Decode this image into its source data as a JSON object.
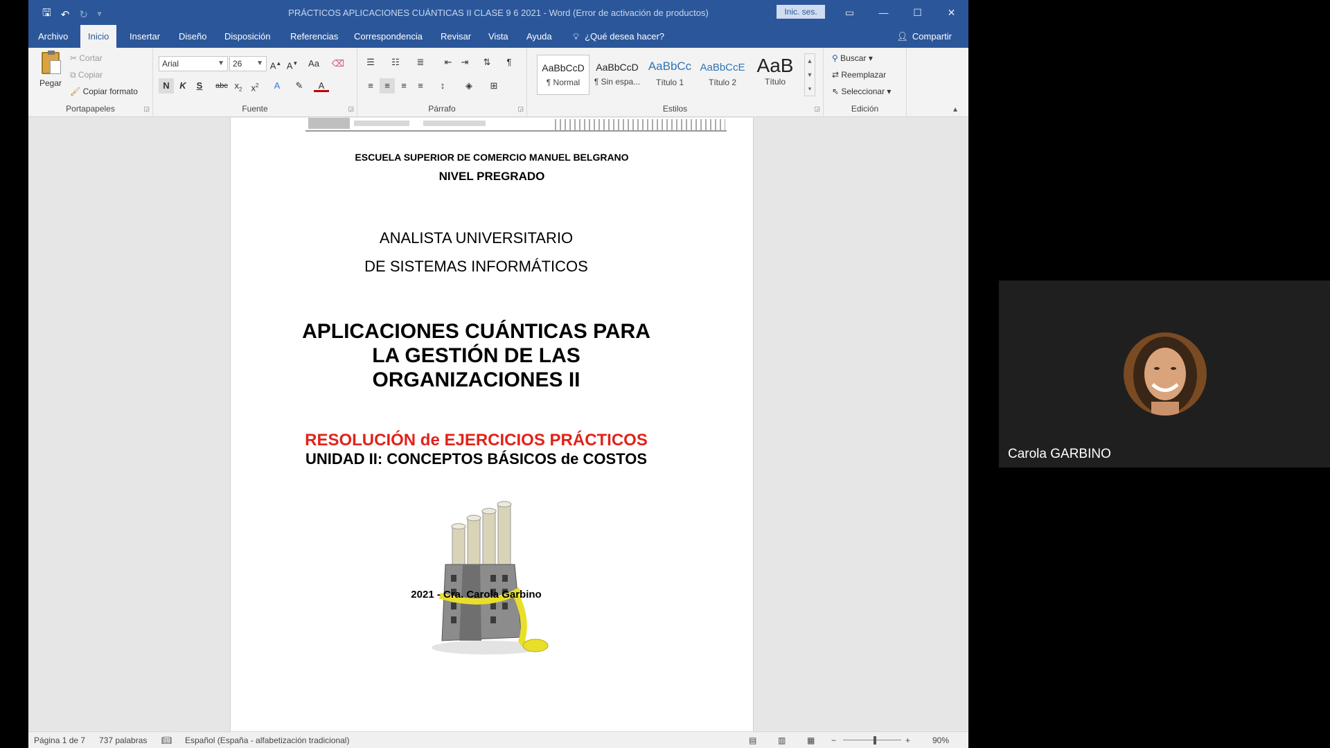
{
  "window": {
    "title": "PRÁCTICOS APLICACIONES CUÁNTICAS II  CLASE 9 6 2021  -  Word (Error de activación de productos)",
    "signin_label": "Inic. ses.",
    "accent": "#2b579a"
  },
  "tabs": [
    "Archivo",
    "Inicio",
    "Insertar",
    "Diseño",
    "Disposición",
    "Referencias",
    "Correspondencia",
    "Revisar",
    "Vista",
    "Ayuda"
  ],
  "tellme": "¿Qué desea hacer?",
  "share": "Compartir",
  "ribbon": {
    "clipboard": {
      "paste": "Pegar",
      "cut": "Cortar",
      "copy": "Copiar",
      "format_painter": "Copiar formato",
      "label": "Portapapeles"
    },
    "font": {
      "name": "Arial",
      "size": "26",
      "label": "Fuente",
      "bold": "N",
      "italic": "K",
      "underline": "S",
      "strike": "abc",
      "change_case": "Aa"
    },
    "paragraph": {
      "label": "Párrafo"
    },
    "styles": {
      "label": "Estilos",
      "items": [
        {
          "preview": "AaBbCcD",
          "name": "¶ Normal"
        },
        {
          "preview": "AaBbCcD",
          "name": "¶ Sin espa..."
        },
        {
          "preview": "AaBbCc",
          "name": "Título 1"
        },
        {
          "preview": "AaBbCcE",
          "name": "Título 2"
        },
        {
          "preview": "AaB",
          "name": "Título"
        }
      ]
    },
    "editing": {
      "find": "Buscar",
      "replace": "Reemplazar",
      "select": "Seleccionar",
      "label": "Edición"
    }
  },
  "document": {
    "school": "ESCUELA SUPERIOR DE COMERCIO MANUEL BELGRANO",
    "level": "NIVEL PREGRADO",
    "degree_1": "ANALISTA UNIVERSITARIO",
    "degree_2": "DE SISTEMAS INFORMÁTICOS",
    "subject_1": "APLICACIONES CUÁNTICAS PARA",
    "subject_2": "LA GESTIÓN DE LAS",
    "subject_3": "ORGANIZACIONES II",
    "resolution": "RESOLUCIÓN de EJERCICIOS PRÁCTICOS",
    "unit": "UNIDAD II: CONCEPTOS BÁSICOS de COSTOS",
    "author": "2021 - Cra. Carola Garbino",
    "red": "#e0231a"
  },
  "status": {
    "page": "Página 1 de 7",
    "words": "737 palabras",
    "language": "Español (España - alfabetización tradicional)",
    "zoom": "90%"
  },
  "participant": {
    "name": "Carola GARBINO"
  }
}
